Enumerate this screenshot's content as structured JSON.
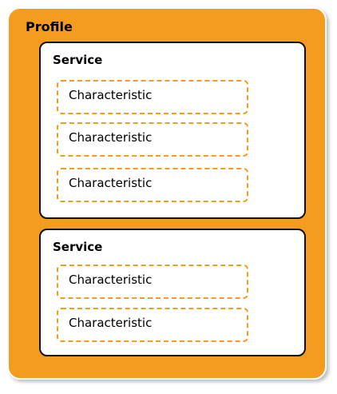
{
  "profile": {
    "title": "Profile",
    "color": "#F39C1F",
    "services": [
      {
        "title": "Service",
        "characteristics": [
          "Characteristic",
          "Characteristic",
          "Characteristic"
        ]
      },
      {
        "title": "Service",
        "characteristics": [
          "Characteristic",
          "Characteristic"
        ]
      }
    ]
  }
}
